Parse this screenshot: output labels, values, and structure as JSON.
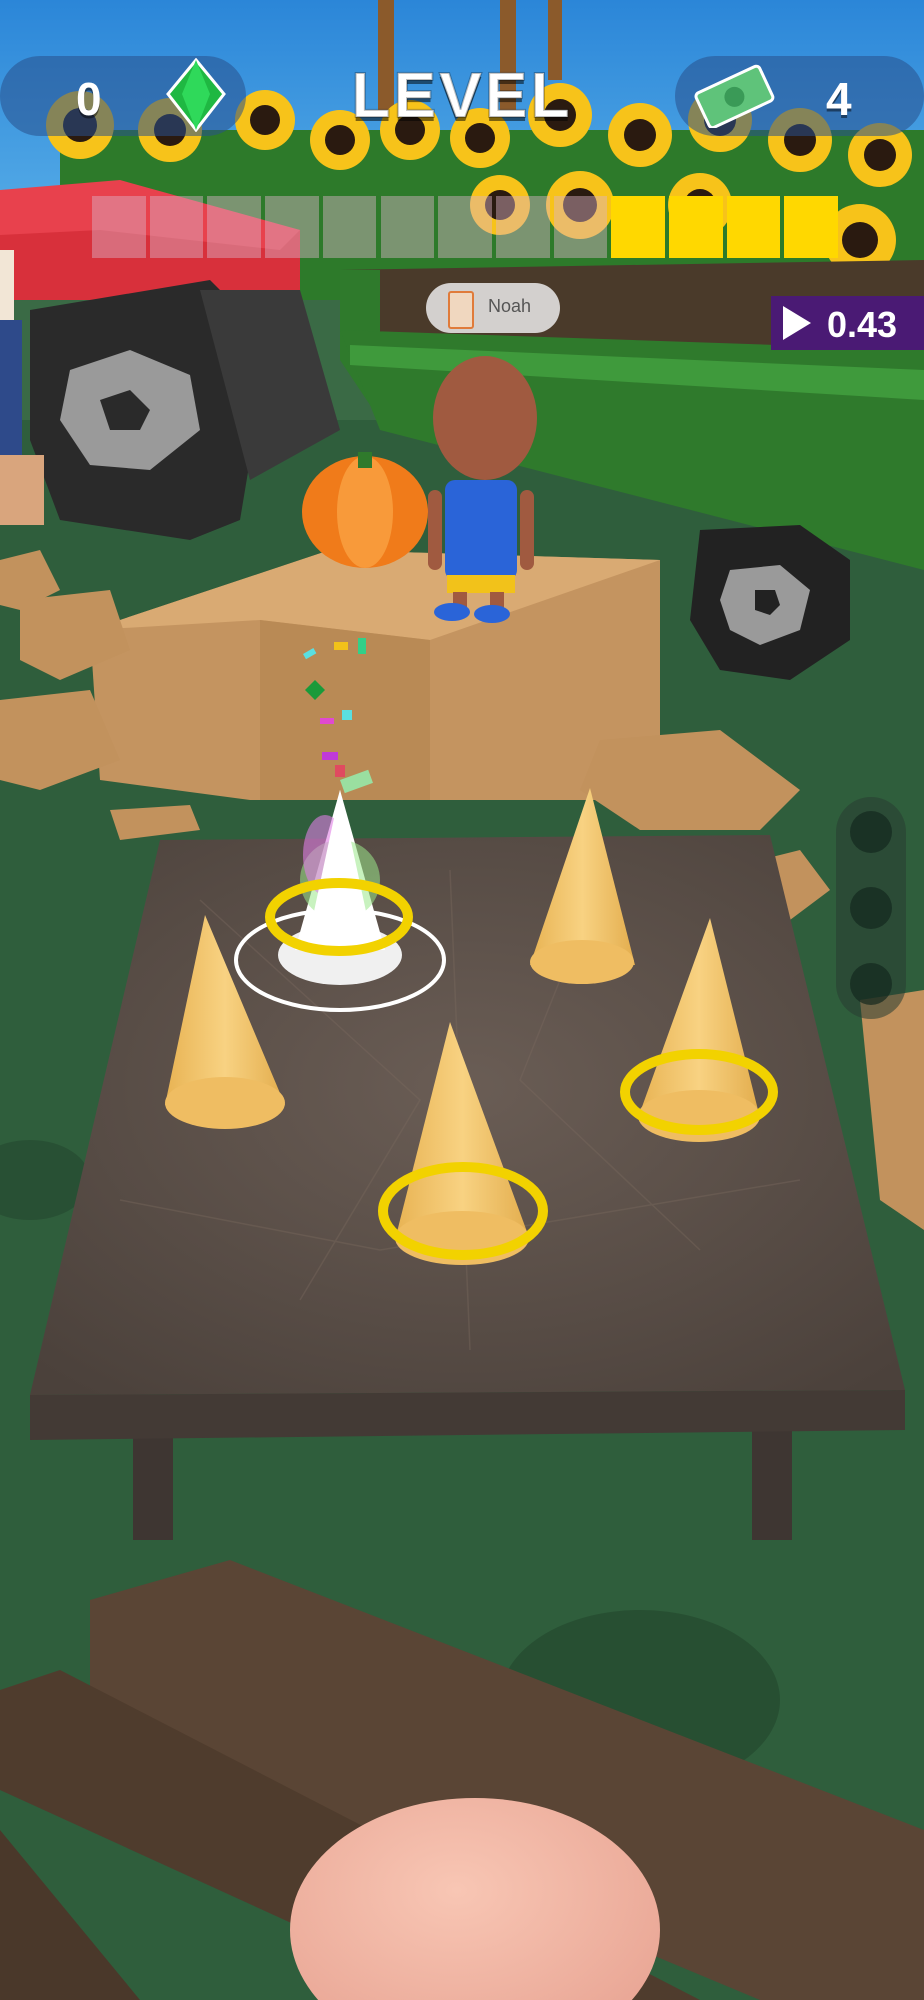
{
  "hud": {
    "gems": "0",
    "level_title": "LEVEL",
    "cash": "4",
    "gem_icon": "green-gem-icon",
    "cash_icon": "banknote-icon"
  },
  "level_progress": {
    "total_segments": 13,
    "filled_segments": 4,
    "filled_color": "#FFD800"
  },
  "player": {
    "name": "Noah"
  },
  "timer": {
    "value": "0.43"
  },
  "colors": {
    "grass": "#2f5e3c",
    "table": "#5b5049",
    "cone": "#f4c667",
    "ring": "#f2d200",
    "sky": "#2b86d8",
    "tractor_red": "#d8303b",
    "trailer_green": "#2f7a2c"
  }
}
